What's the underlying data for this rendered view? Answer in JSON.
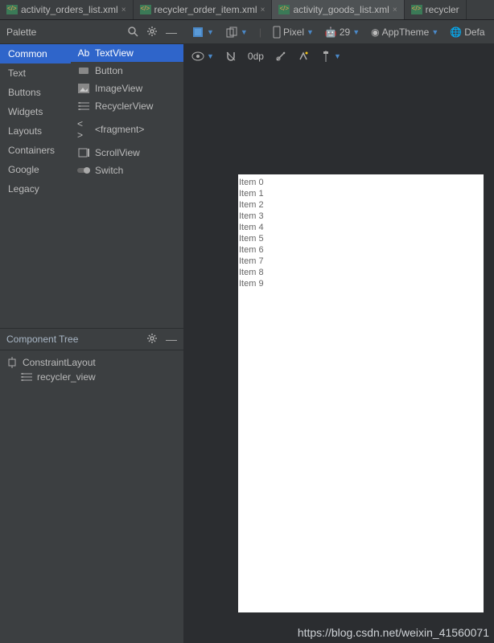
{
  "tabs": [
    {
      "label": "activity_orders_list.xml",
      "active": false
    },
    {
      "label": "recycler_order_item.xml",
      "active": false
    },
    {
      "label": "activity_goods_list.xml",
      "active": true
    },
    {
      "label": "recycler",
      "active": false
    }
  ],
  "palette": {
    "title": "Palette",
    "categories": [
      "Common",
      "Text",
      "Buttons",
      "Widgets",
      "Layouts",
      "Containers",
      "Google",
      "Legacy"
    ],
    "activeCategory": "Common",
    "components": [
      {
        "icon": "Ab",
        "label": "TextView",
        "active": true
      },
      {
        "icon": "btn",
        "label": "Button",
        "active": false
      },
      {
        "icon": "img",
        "label": "ImageView",
        "active": false
      },
      {
        "icon": "list",
        "label": "RecyclerView",
        "active": false
      },
      {
        "icon": "frag",
        "label": "<fragment>",
        "active": false
      },
      {
        "icon": "scroll",
        "label": "ScrollView",
        "active": false
      },
      {
        "icon": "switch",
        "label": "Switch",
        "active": false
      }
    ]
  },
  "componentTree": {
    "title": "Component Tree",
    "root": "ConstraintLayout",
    "child": "recycler_view"
  },
  "designToolbar": {
    "device": "Pixel",
    "api": "29",
    "theme": "AppTheme",
    "locale": "Defa",
    "zeroDp": "0dp"
  },
  "previewItems": [
    "Item 0",
    "Item 1",
    "Item 2",
    "Item 3",
    "Item 4",
    "Item 5",
    "Item 6",
    "Item 7",
    "Item 8",
    "Item 9"
  ],
  "watermark": "https://blog.csdn.net/weixin_41560071"
}
